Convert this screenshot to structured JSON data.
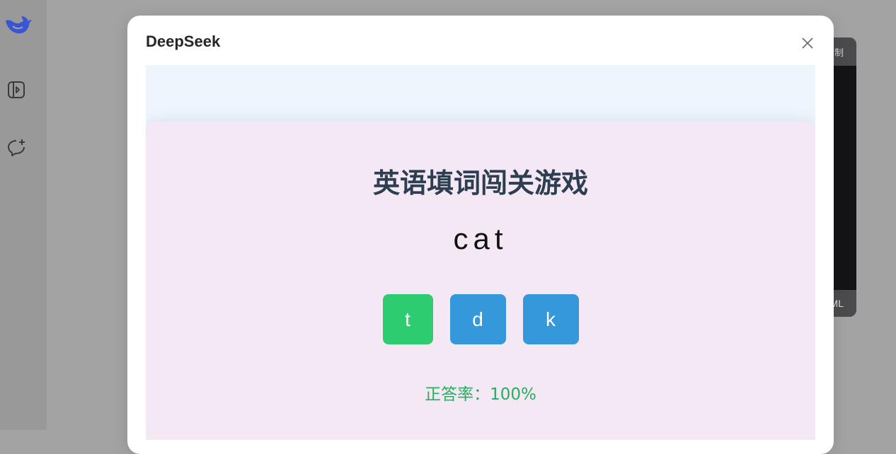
{
  "sidebar": {
    "logo_icon": "deepseek-whale-icon",
    "panel_icon": "sidebar-toggle-icon",
    "new_chat_icon": "new-chat-icon",
    "logo_color": "#4d6bfe"
  },
  "background_code": {
    "header_label": "制",
    "footer_label": "ML"
  },
  "modal": {
    "title": "DeepSeek",
    "close_icon": "close-icon"
  },
  "game": {
    "title": "英语填词闯关游戏",
    "word": "cat",
    "options": [
      {
        "label": "t",
        "state": "correct",
        "color": "#2ecc71"
      },
      {
        "label": "d",
        "state": "default",
        "color": "#3498db"
      },
      {
        "label": "k",
        "state": "default",
        "color": "#3498db"
      }
    ],
    "accuracy_text": "正答率：100%"
  }
}
